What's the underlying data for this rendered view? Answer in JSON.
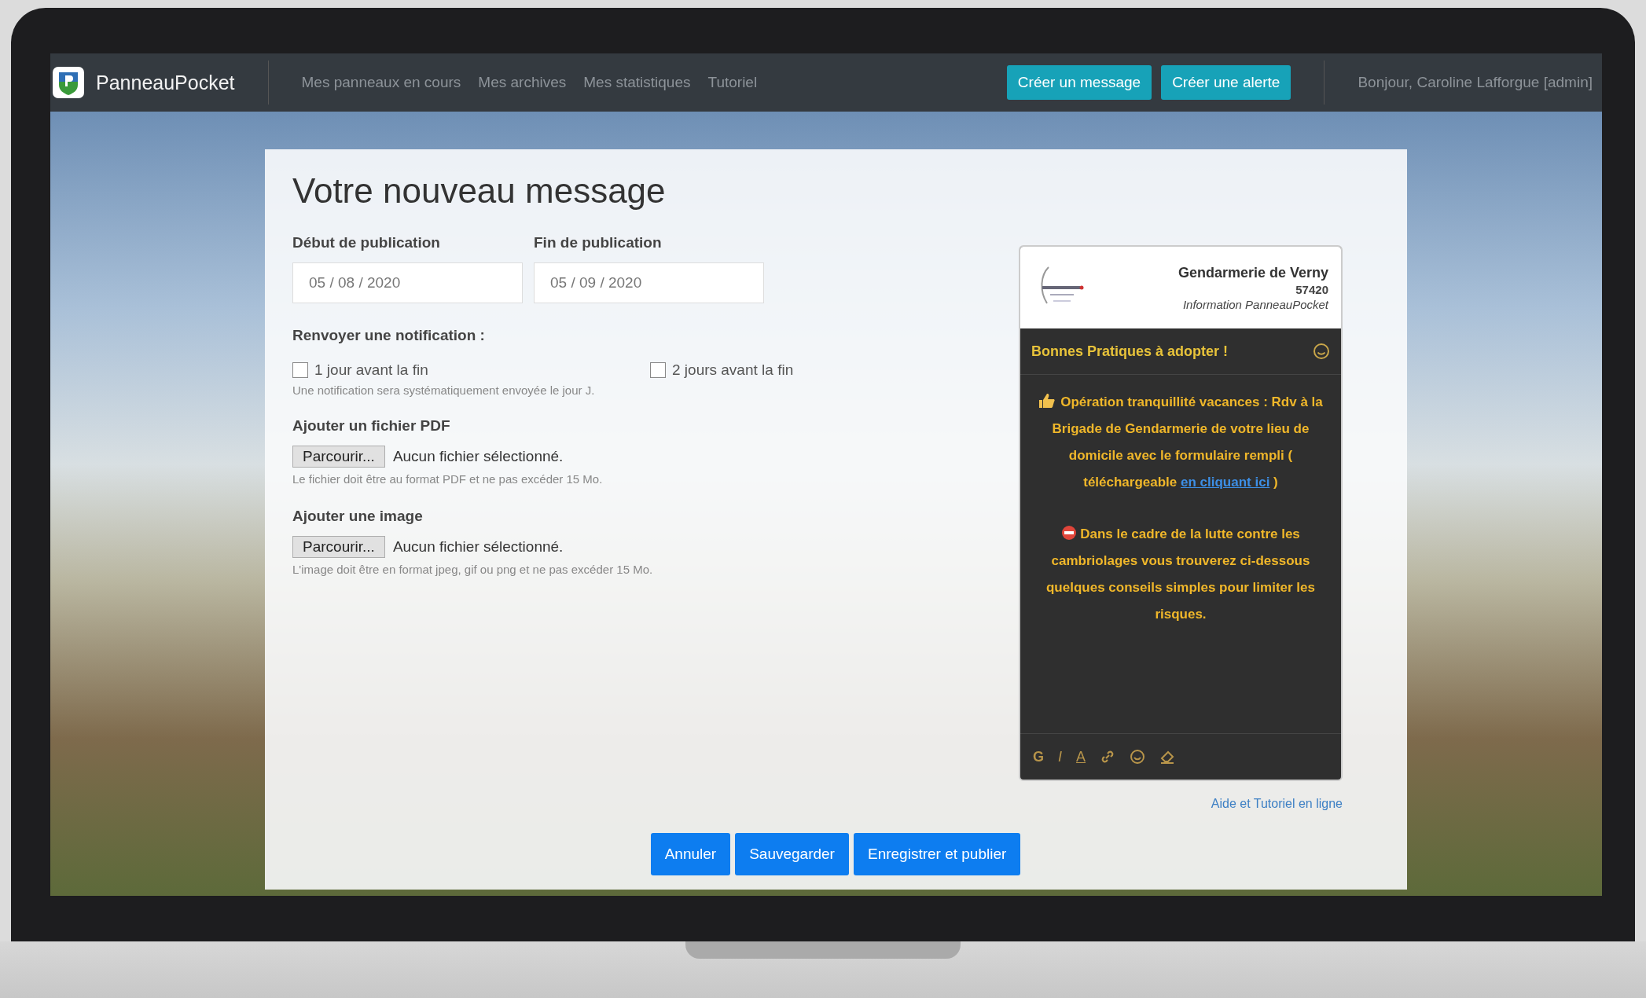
{
  "navbar": {
    "brand": "PanneauPocket",
    "links": [
      "Mes panneaux en cours",
      "Mes archives",
      "Mes statistiques",
      "Tutoriel"
    ],
    "actions": [
      "Créer un message",
      "Créer une alerte"
    ],
    "greeting": "Bonjour, Caroline Lafforgue [admin]"
  },
  "form": {
    "title": "Votre nouveau message",
    "dates": [
      {
        "label": "Début de publication",
        "value": "05 / 08 / 2020"
      },
      {
        "label": "Fin de publication",
        "value": "05 / 09 / 2020"
      }
    ],
    "notification": {
      "label": "Renvoyer une notification :",
      "options": [
        {
          "label": "1 jour avant la fin",
          "checked": false
        },
        {
          "label": "2 jours avant la fin",
          "checked": false
        }
      ],
      "help": "Une notification sera systématiquement envoyée le jour J."
    },
    "uploads": [
      {
        "label": "Ajouter un fichier PDF",
        "button": "Parcourir...",
        "status": "Aucun fichier sélectionné.",
        "help": "Le fichier doit être au format PDF et ne pas excéder 15 Mo."
      },
      {
        "label": "Ajouter une image",
        "button": "Parcourir...",
        "status": "Aucun fichier sélectionné.",
        "help": "L'image doit être en format jpeg, gif ou png et ne pas excéder 15 Mo."
      }
    ],
    "buttons": [
      "Annuler",
      "Sauvegarder",
      "Enregistrer et publier"
    ]
  },
  "preview": {
    "org_name": "Gendarmerie de Verny",
    "postcode": "57420",
    "source": "Information PanneauPocket",
    "title": "Bonnes Pratiques à adopter !",
    "paragraphs": [
      {
        "kind": "thumb",
        "text": "Opération tranquillité vacances : Rdv à la Brigade de Gendarmerie de votre lieu de domicile avec le formulaire rempli ( téléchargeable ",
        "link": "en cliquant ici",
        "after": " )"
      },
      {
        "kind": "stop",
        "text": "Dans le cadre de la lutte contre les cambriolages vous trouverez ci-dessous quelques conseils simples pour limiter les risques."
      }
    ],
    "toolbar": [
      "G",
      "I",
      "A"
    ]
  },
  "help_link": "Aide et Tutoriel en ligne"
}
